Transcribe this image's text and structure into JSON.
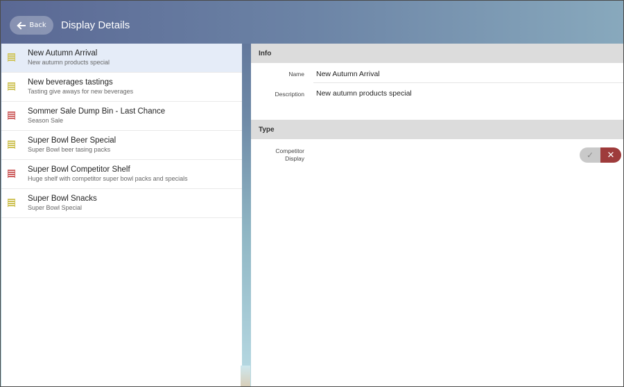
{
  "header": {
    "back_label": "Back",
    "title": "Display Details"
  },
  "displays": [
    {
      "title": "New Autumn Arrival",
      "subtitle": "New autumn products special",
      "status": "yellow",
      "selected": true
    },
    {
      "title": "New beverages tastings",
      "subtitle": "Tasting give aways for new beverages",
      "status": "yellow",
      "selected": false
    },
    {
      "title": "Sommer Sale Dump Bin - Last Chance",
      "subtitle": "Season Sale",
      "status": "red",
      "selected": false
    },
    {
      "title": "Super Bowl Beer Special",
      "subtitle": "Super Bowl beer tasing packs",
      "status": "yellow",
      "selected": false
    },
    {
      "title": "Super Bowl Competitor Shelf",
      "subtitle": "Huge shelf with competitor super bowl packs and specials",
      "status": "red",
      "selected": false
    },
    {
      "title": "Super Bowl Snacks",
      "subtitle": "Super Bowl Special",
      "status": "yellow",
      "selected": false
    }
  ],
  "info": {
    "header": "Info",
    "name_label": "Name",
    "name_value": "New Autumn Arrival",
    "description_label": "Description",
    "description_value": "New autumn products special"
  },
  "type": {
    "header": "Type",
    "competitor_label_line1": "Competitor",
    "competitor_label_line2": "Display",
    "competitor_value": false,
    "yes_icon": "check-icon",
    "no_icon": "close-icon"
  },
  "colors": {
    "status_yellow": "#cfc45a",
    "status_red": "#cf6565",
    "selected_row": "#e5ecf8",
    "toggle_no": "#9e3b3b"
  }
}
